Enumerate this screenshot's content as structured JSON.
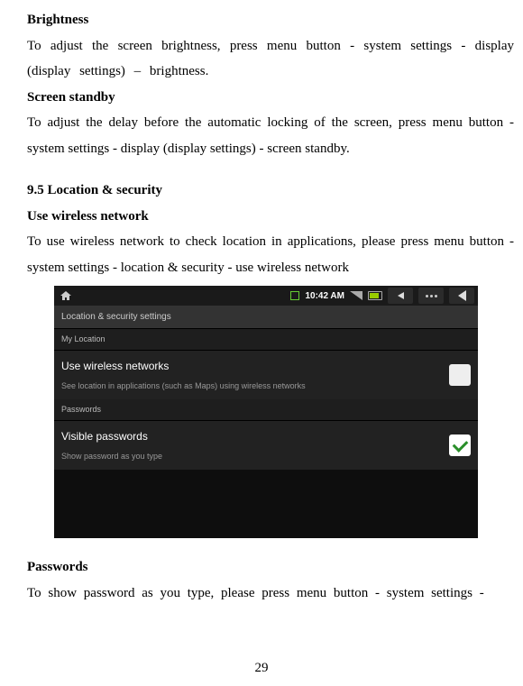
{
  "headings": {
    "brightness": "Brightness",
    "screen_standby": "Screen standby",
    "section95": "9.5 Location & security",
    "use_wireless": "Use wireless network",
    "passwords": "Passwords"
  },
  "paras": {
    "brightness": "To adjust the screen brightness, press menu button - system settings - display (display settings) – brightness.",
    "standby": "To adjust the delay before the automatic locking of the screen, press menu button - system settings - display (display settings) - screen standby.",
    "wireless": "To use wireless network to check location in applications, please press menu button - system settings - location & security - use wireless network",
    "passwords": "To show password as you type, please   press menu button - system settings -"
  },
  "screenshot": {
    "statusbar": {
      "time": "10:42 AM"
    },
    "title": "Location & security settings",
    "group1": "My Location",
    "row1": {
      "title": "Use wireless networks",
      "sub": "See location in applications (such as Maps) using wireless networks"
    },
    "group2": "Passwords",
    "row2": {
      "title": "Visible passwords",
      "sub": "Show password as you type"
    }
  },
  "page": "29"
}
